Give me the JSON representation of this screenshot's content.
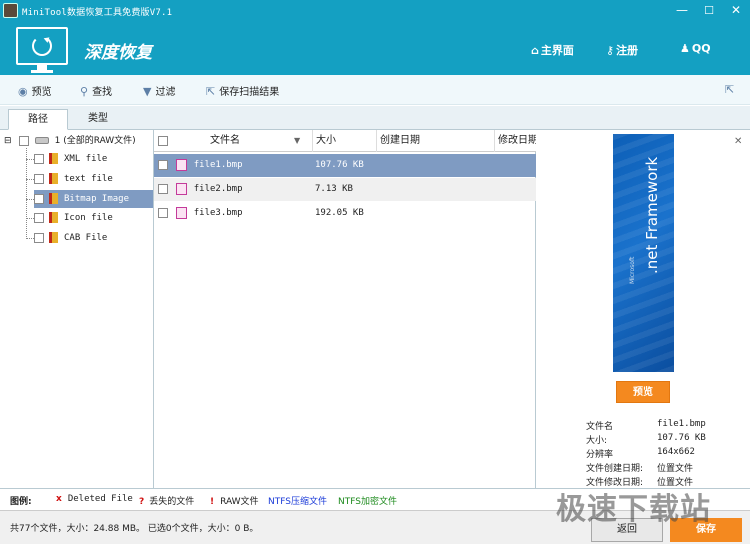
{
  "window": {
    "title": "MiniTool数据恢复工具免费版V7.1",
    "minimize": "—",
    "maximize": "☐",
    "close": "✕"
  },
  "header": {
    "title": "深度恢复",
    "nav": [
      {
        "icon": "home-icon",
        "label": "主界面"
      },
      {
        "icon": "key-icon",
        "label": "注册"
      },
      {
        "icon": "qq-penguin-icon",
        "label": "QQ"
      }
    ]
  },
  "toolbar": {
    "preview": "预览",
    "find": "查找",
    "filter": "过滤",
    "save_scan": "保存扫描结果"
  },
  "tabs": [
    "路径",
    "类型"
  ],
  "tree": {
    "root": "1 (全部的RAW文件)",
    "items": [
      "XML file",
      "text file",
      "Bitmap Image",
      "Icon file",
      "CAB File"
    ],
    "selected_index": 2
  },
  "filelist": {
    "columns": [
      "文件名",
      "大小",
      "创建日期",
      "修改日期"
    ],
    "rows": [
      {
        "name": "file1.bmp",
        "size": "107.76 KB"
      },
      {
        "name": "file2.bmp",
        "size": "7.13 KB"
      },
      {
        "name": "file3.bmp",
        "size": "192.05 KB"
      }
    ],
    "selected_index": 0
  },
  "preview": {
    "image_text": ".net Framework",
    "image_small": "Microsoft",
    "button": "预览",
    "close": "✕",
    "info": [
      {
        "k": "文件名",
        "v": "file1.bmp"
      },
      {
        "k": "大小:",
        "v": "107.76 KB"
      },
      {
        "k": "分辨率",
        "v": "164x662"
      },
      {
        "k": "文件创建日期:",
        "v": "位置文件"
      },
      {
        "k": "文件修改日期:",
        "v": "位置文件"
      }
    ]
  },
  "legend": {
    "label": "图例:",
    "items": [
      {
        "mark": "x",
        "text": "Deleted File",
        "color": "#222222"
      },
      {
        "mark": "?",
        "text": "丢失的文件",
        "color": "#222222"
      },
      {
        "mark": "!",
        "text": "RAW文件",
        "color": "#222222"
      },
      {
        "mark": "",
        "text": "NTFS压缩文件",
        "color": "#1a3ad8"
      },
      {
        "mark": "",
        "text": "NTFS加密文件",
        "color": "#1c8a1c"
      }
    ]
  },
  "status": {
    "text": "共77个文件，大小：24.88 MB。 已选0个文件，大小：0 B。",
    "back": "返回",
    "save": "保存"
  },
  "watermark": "极速下载站",
  "colors": {
    "accent": "#14a0c2",
    "orange": "#f4891f",
    "selection": "#7f9bc2"
  }
}
